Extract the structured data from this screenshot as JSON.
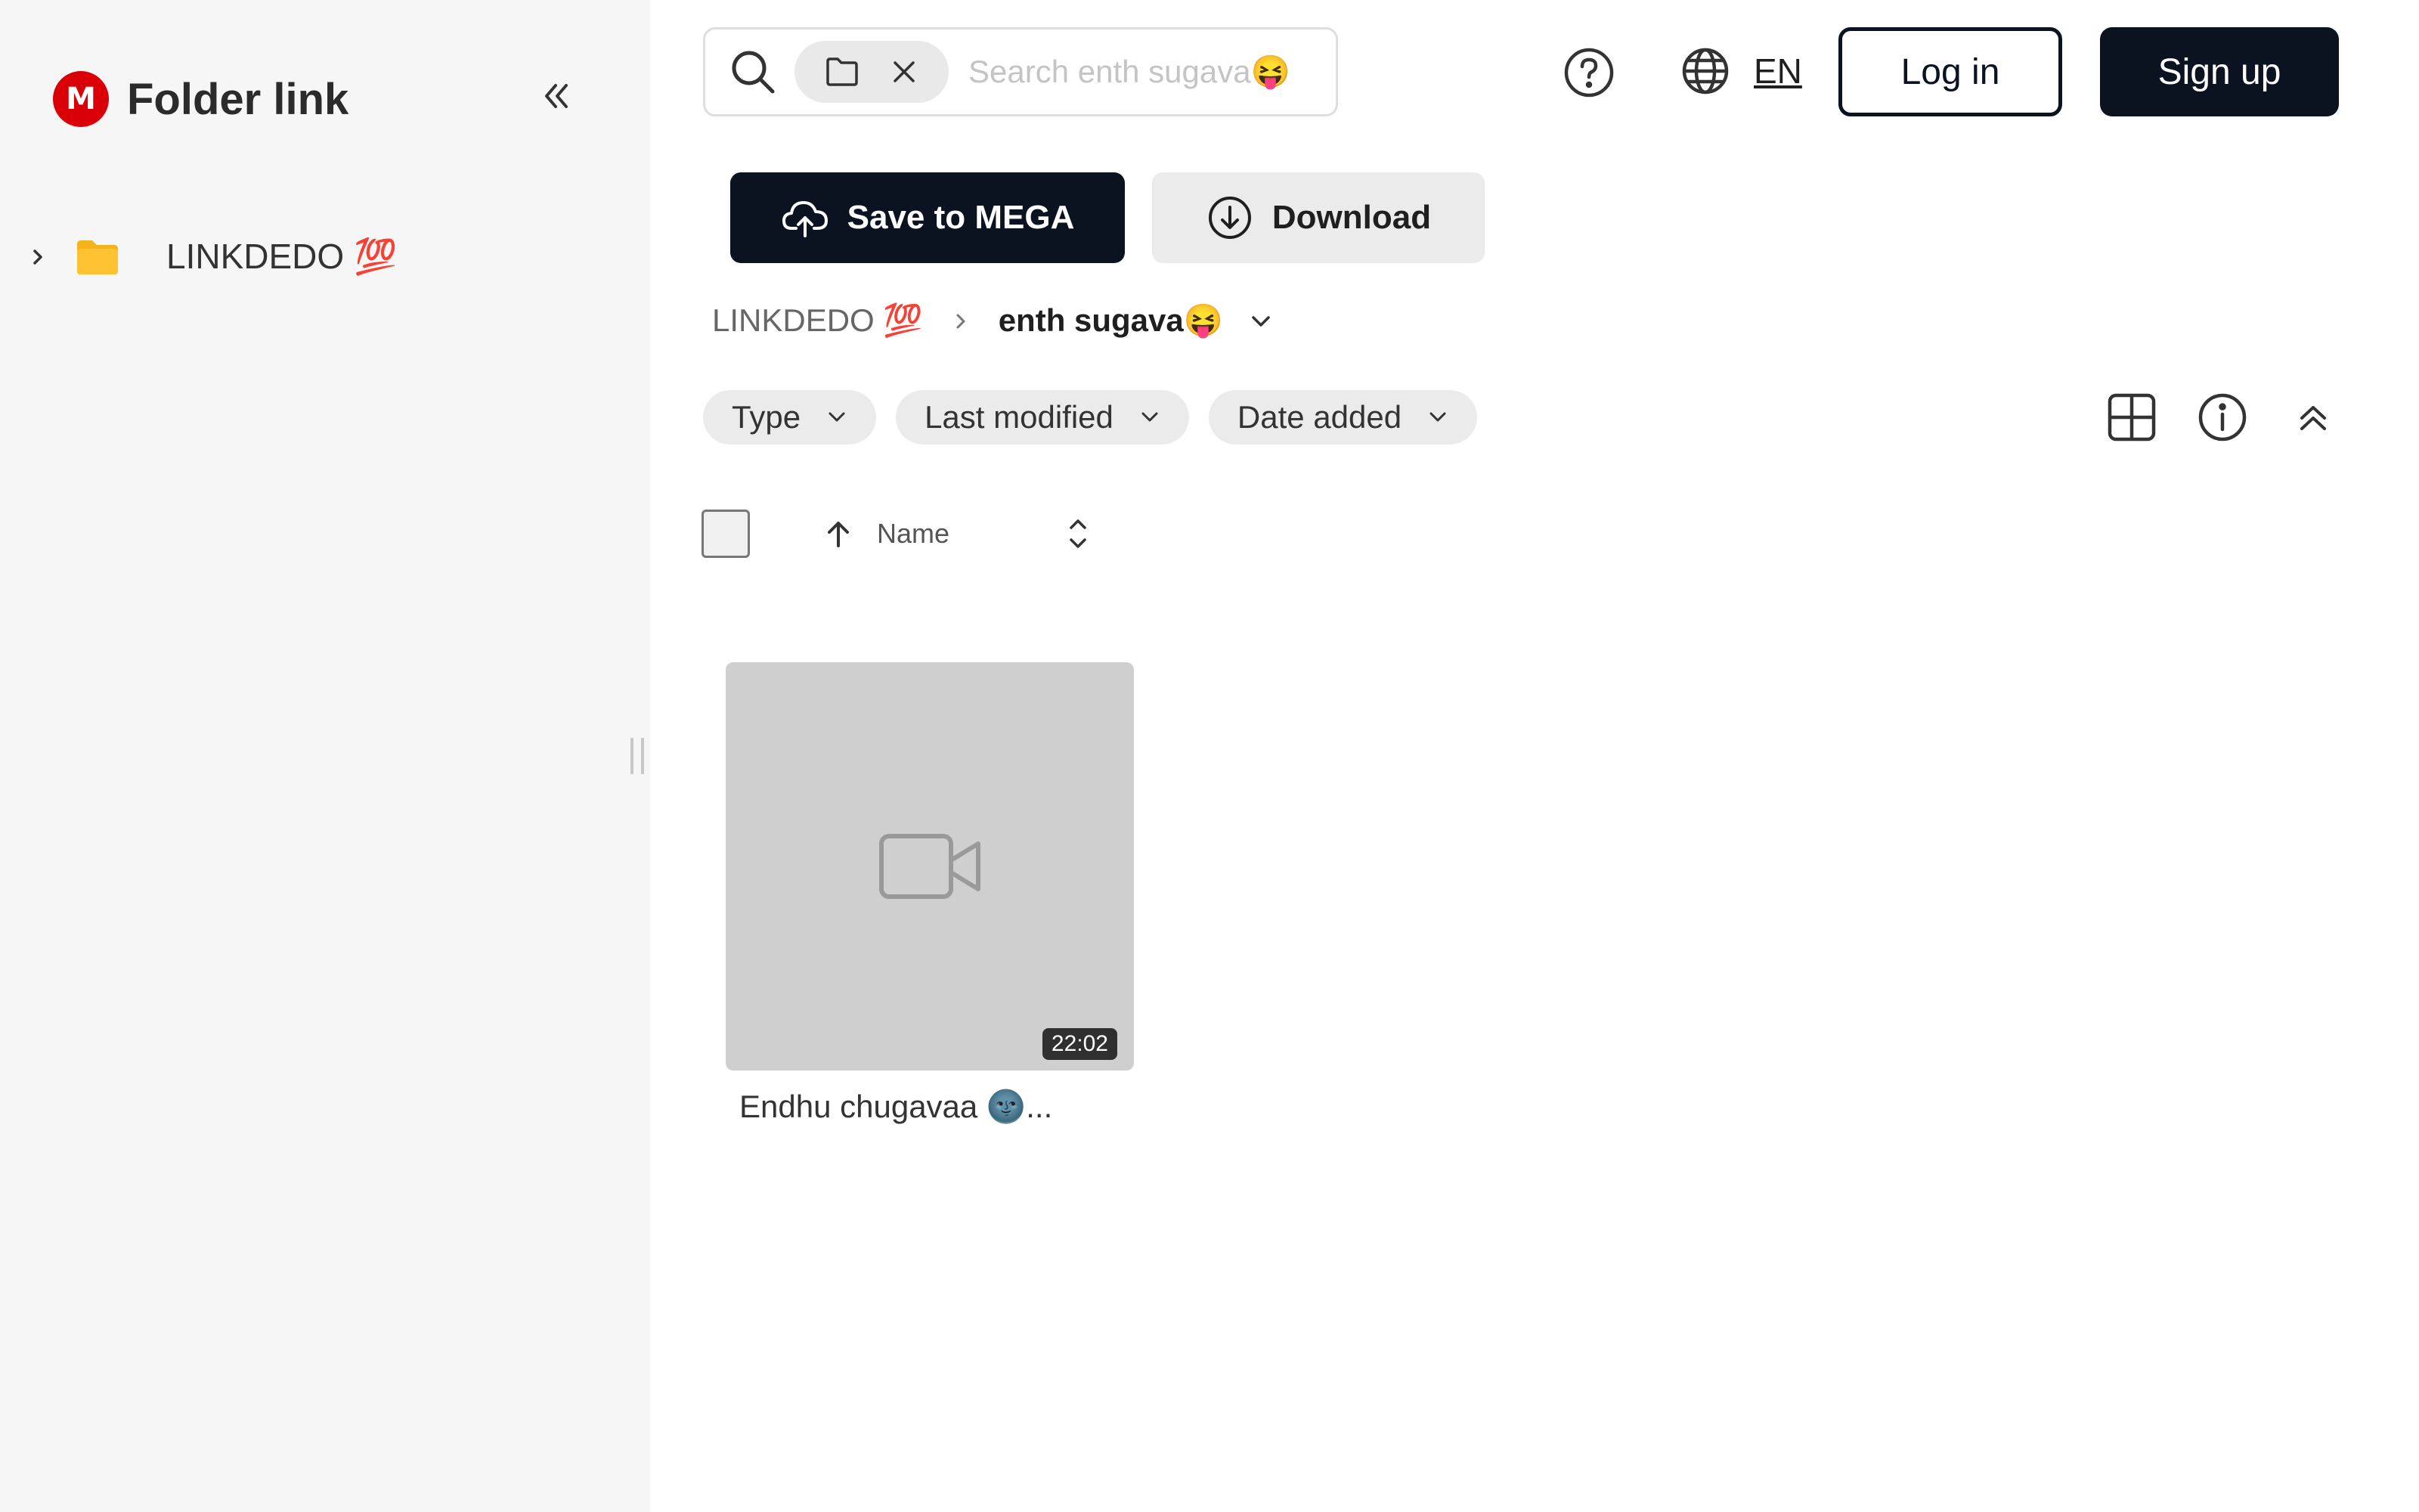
{
  "sidebar": {
    "logo_letter": "M",
    "title": "Folder link",
    "tree": [
      {
        "label": "LINKDEDO 💯",
        "icon": "folder-icon"
      }
    ]
  },
  "header": {
    "search": {
      "placeholder": "Search enth sugava😝",
      "value": ""
    },
    "lang": "EN",
    "login_label": "Log in",
    "signup_label": "Sign up"
  },
  "actions": {
    "save_label": "Save to MEGA",
    "download_label": "Download"
  },
  "breadcrumb": {
    "root": "LINKDEDO 💯",
    "current": "enth sugava😝"
  },
  "filters": [
    "Type",
    "Last modified",
    "Date added"
  ],
  "list": {
    "name_column": "Name",
    "sort": "ascending"
  },
  "files": [
    {
      "name": "Endhu chugavaa 🌚...",
      "duration": "22:02",
      "kind": "video"
    }
  ],
  "colors": {
    "brand": "#d90007",
    "primary": "#0b1220",
    "folder": "#f5b31b",
    "sidebar_bg": "#f6f6f6"
  }
}
